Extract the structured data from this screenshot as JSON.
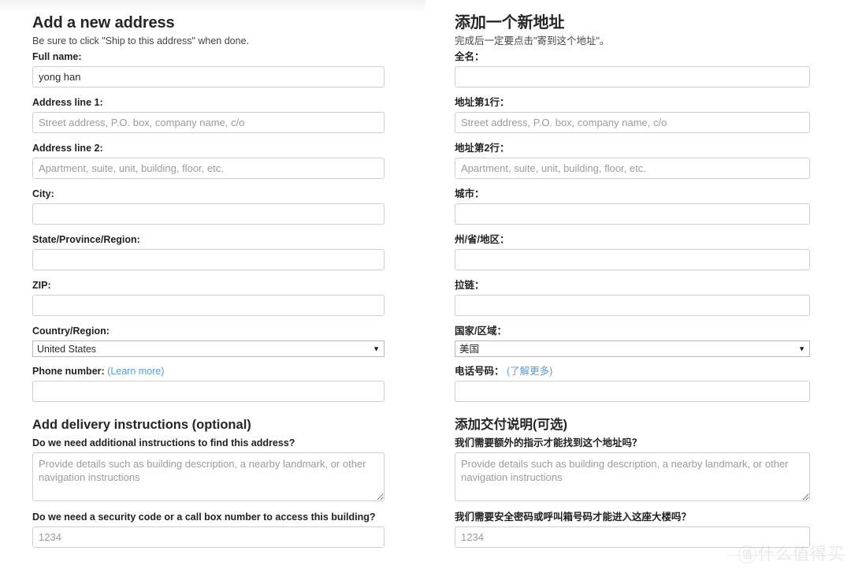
{
  "left": {
    "title": "Add a new address",
    "subtitle": "Be sure to click \"Ship to this address\" when done.",
    "fields": {
      "full_name_label": "Full name:",
      "full_name_value": "yong han",
      "full_name_placeholder": "",
      "address1_label": "Address line 1:",
      "address1_value": "",
      "address1_placeholder": "Street address, P.O. box, company name, c/o",
      "address2_label": "Address line 2:",
      "address2_value": "",
      "address2_placeholder": "Apartment, suite, unit, building, floor, etc.",
      "city_label": "City:",
      "city_value": "",
      "city_placeholder": "",
      "state_label": "State/Province/Region:",
      "state_value": "",
      "state_placeholder": "",
      "zip_label": "ZIP:",
      "zip_value": "",
      "zip_placeholder": "",
      "country_label": "Country/Region:",
      "country_selected": "United States",
      "country_options": [
        "United States"
      ],
      "phone_label": "Phone number:",
      "phone_learn_more": "(Learn more)",
      "phone_value": "",
      "phone_placeholder": ""
    },
    "delivery": {
      "title": "Add delivery instructions (optional)",
      "question1": "Do we need additional instructions to find this address?",
      "instructions_value": "",
      "instructions_placeholder": "Provide details such as building description, a nearby landmark, or other navigation instructions",
      "question2": "Do we need a security code or a call box number to access this building?",
      "security_value": "",
      "security_placeholder": "1234"
    }
  },
  "right": {
    "title": "添加一个新地址",
    "subtitle": "完成后一定要点击\"寄到这个地址\"。",
    "fields": {
      "full_name_label": "全名：",
      "full_name_value": "",
      "full_name_placeholder": "",
      "address1_label": "地址第1行：",
      "address1_value": "",
      "address1_placeholder": "Street address, P.O. box, company name, c/o",
      "address2_label": "地址第2行：",
      "address2_value": "",
      "address2_placeholder": "Apartment, suite, unit, building, floor, etc.",
      "city_label": "城市：",
      "city_value": "",
      "city_placeholder": "",
      "state_label": "州/省/地区：",
      "state_value": "",
      "state_placeholder": "",
      "zip_label": "拉链：",
      "zip_value": "",
      "zip_placeholder": "",
      "country_label": "国家/区域：",
      "country_selected": "美国",
      "country_options": [
        "美国"
      ],
      "phone_label": "电话号码：",
      "phone_learn_more": "(了解更多)",
      "phone_value": "",
      "phone_placeholder": ""
    },
    "delivery": {
      "title": "添加交付说明(可选)",
      "question1": "我们需要额外的指示才能找到这个地址吗？",
      "instructions_value": "",
      "instructions_placeholder": "Provide details such as building description, a nearby landmark, or other navigation instructions",
      "question2": "我们需要安全密码或呼叫箱号码才能进入这座大楼吗？",
      "security_value": "",
      "security_placeholder": "1234"
    }
  },
  "watermark": {
    "badge": "值",
    "text": "什么值得买"
  },
  "icons": {
    "select_arrow": "▼"
  },
  "colors": {
    "link": "#5b9dd9",
    "text": "#222222",
    "placeholder": "#9b9b9b",
    "border": "#cfcfcf"
  }
}
